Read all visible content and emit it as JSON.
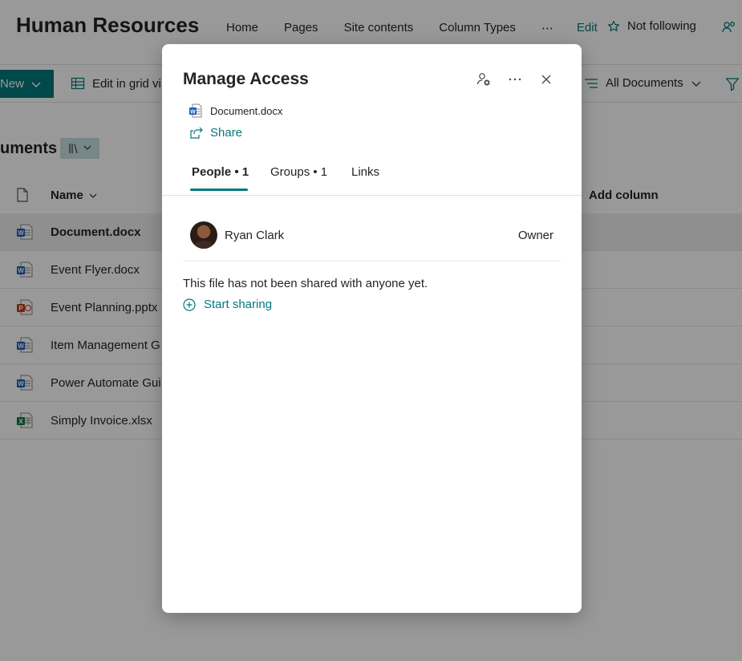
{
  "site": {
    "title": "Human Resources",
    "nav": [
      "Home",
      "Pages",
      "Site contents",
      "Column Types"
    ],
    "nav_more": "⋯",
    "edit": "Edit",
    "follow": "Not following"
  },
  "command_bar": {
    "new_label": "New",
    "grid_label": "Edit in grid vi",
    "view_label": "All Documents"
  },
  "library": {
    "title": "uments",
    "columns": {
      "name": "Name",
      "add_column": "Add column"
    },
    "files": [
      {
        "name": "Document.docx",
        "type": "word",
        "selected": true
      },
      {
        "name": "Event Flyer.docx",
        "type": "word",
        "selected": false
      },
      {
        "name": "Event Planning.pptx",
        "type": "powerpoint",
        "selected": false
      },
      {
        "name": "Item Management G",
        "type": "word",
        "selected": false
      },
      {
        "name": "Power Automate Gui",
        "type": "word",
        "selected": false
      },
      {
        "name": "Simply Invoice.xlsx",
        "type": "excel",
        "selected": false
      }
    ]
  },
  "dialog": {
    "title": "Manage Access",
    "file_name": "Document.docx",
    "share_label": "Share",
    "tabs": [
      {
        "label": "People • 1",
        "active": true
      },
      {
        "label": "Groups • 1",
        "active": false
      },
      {
        "label": "Links",
        "active": false
      }
    ],
    "people": [
      {
        "name": "Ryan Clark",
        "role": "Owner"
      }
    ],
    "empty_message": "This file has not been shared with anyone yet.",
    "start_sharing_label": "Start sharing",
    "icons": [
      "people-add-icon",
      "more-icon",
      "close-icon"
    ]
  },
  "colors": {
    "accent": "#03787c",
    "word": "#185abd",
    "powerpoint": "#c43e1c",
    "excel": "#107c41"
  }
}
